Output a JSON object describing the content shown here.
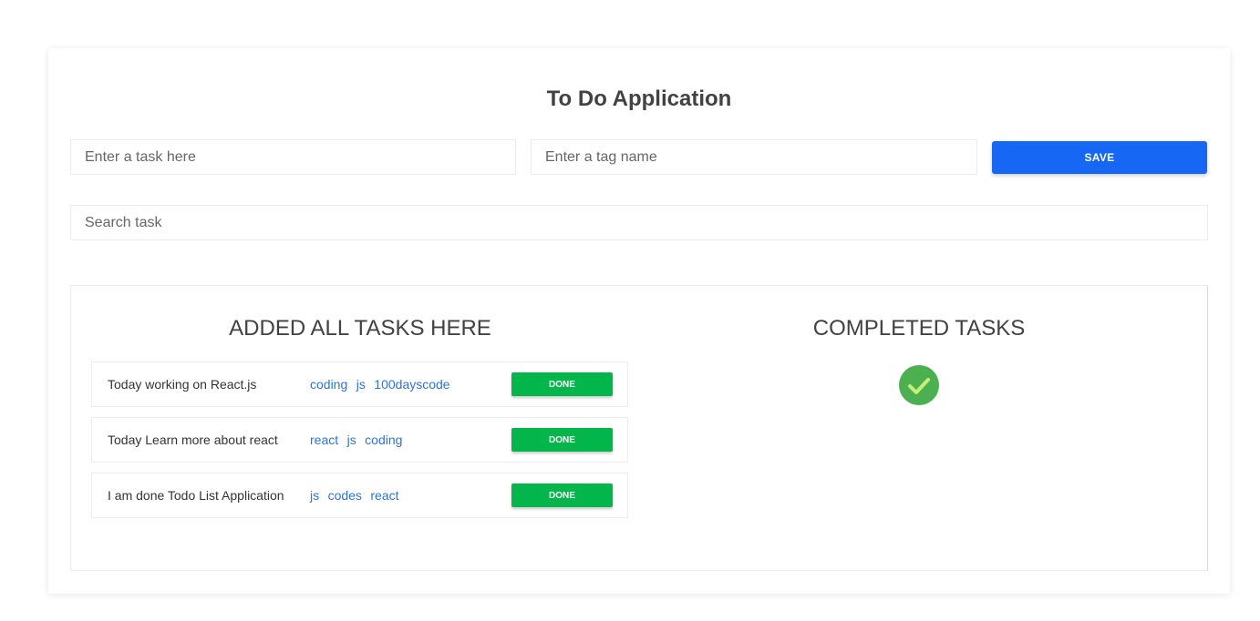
{
  "app": {
    "title": "To Do Application"
  },
  "form": {
    "task_placeholder": "Enter a task here",
    "tag_placeholder": "Enter a tag name",
    "save_label": "SAVE"
  },
  "search": {
    "placeholder": "Search task"
  },
  "tasks_section": {
    "title": "ADDED ALL TASKS HERE",
    "tasks": [
      {
        "text": "Today working on React.js",
        "tags": [
          "coding",
          "js",
          "100dayscode"
        ],
        "button": "DONE"
      },
      {
        "text": "Today Learn more about react",
        "tags": [
          "react",
          "js",
          "coding"
        ],
        "button": "DONE"
      },
      {
        "text": "I am done Todo List Application",
        "tags": [
          "js",
          "codes",
          "react"
        ],
        "button": "DONE"
      }
    ]
  },
  "completed_section": {
    "title": "COMPLETED TASKS",
    "icon": "check-circle-icon"
  },
  "colors": {
    "primary": "#1668f4",
    "done": "#03b64b",
    "tag": "#2f73d4",
    "check_bg": "#4caf50",
    "check_mark": "#c5f078"
  }
}
